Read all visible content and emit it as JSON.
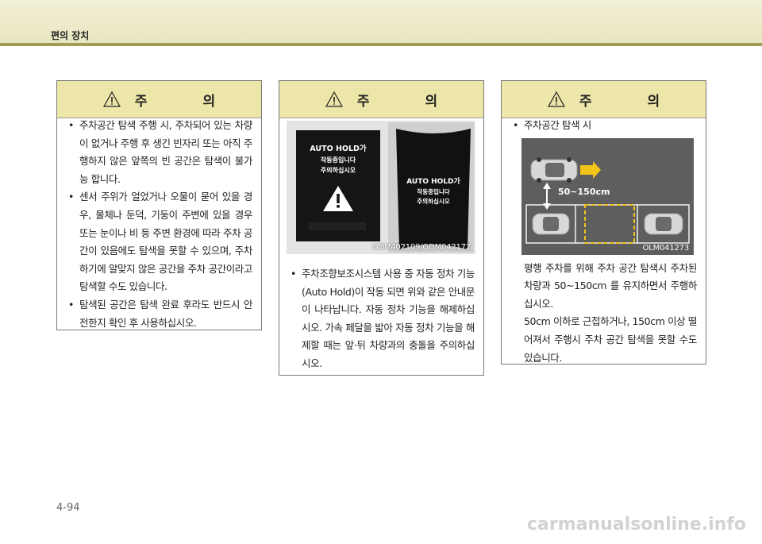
{
  "header": {
    "title": "편의 장치"
  },
  "boxes": [
    {
      "heading": "주 의",
      "items": [
        "주차공간 탐색 주행 시, 주차되어 있는 차량이 없거나 주행 후 생긴 빈자리 또는 아직 주행하지 않은 앞쪽의 빈 공간은 탐색이 불가능 합니다.",
        "센서 주위가 얼었거나 오물이 묻어 있을 경우, 물체나 둔덕, 기둥이 주변에 있을 경우 또는 눈이나 비 등 주변 환경에 따라 주차 공간이 있음에도 탐색을 못할 수 있으며, 주차하기에 알맞지 않은 공간을 주차 공간이라고 탐색할 수도 있습니다.",
        "탐색된 공간은 탐색 완료 후라도 반드시 안전한지 확인 후 사용하십시오."
      ]
    },
    {
      "heading": "주 의",
      "figure": {
        "screen_left_lines": [
          "AUTO HOLD가",
          "작동중입니다",
          "주의하십시오"
        ],
        "screen_right_lines": [
          "AUTO HOLD가",
          "작동중입니다",
          "주의하십시오"
        ],
        "caption": "ODM402109/ODM042172"
      },
      "items": [
        "주차조향보조시스템 사용 중 자동 정차 기능(Auto Hold)이 작동 되면 위와 같은 안내문이 나타납니다. 자동 정차 기능을 해제하십시오. 가속 페달을 밟아 자동 정차 기능을 해제할 때는 앞·뒤 차량과의 충돌을 주의하십시오."
      ]
    },
    {
      "heading": "주 의",
      "items": [
        "주차공간 탐색 시"
      ],
      "figure": {
        "distance_label": "50~150cm",
        "caption": "OLM041273"
      },
      "paragraphs": [
        "평행 주차를 위해 주차 공간 탐색시 주차된 차량과 50~150cm 를 유지하면서 주행하십시오.",
        "50cm 이하로 근접하거나, 150cm 이상 떨어져서 주행시 주차 공간 탐색을 못할 수도 있습니다."
      ]
    }
  ],
  "page_number": "4-94",
  "watermark": "carmanualsonline.info",
  "colors": {
    "header_band": "#f3f1d6",
    "header_rule": "#a19b56",
    "box_heading": "#ece6a8"
  }
}
